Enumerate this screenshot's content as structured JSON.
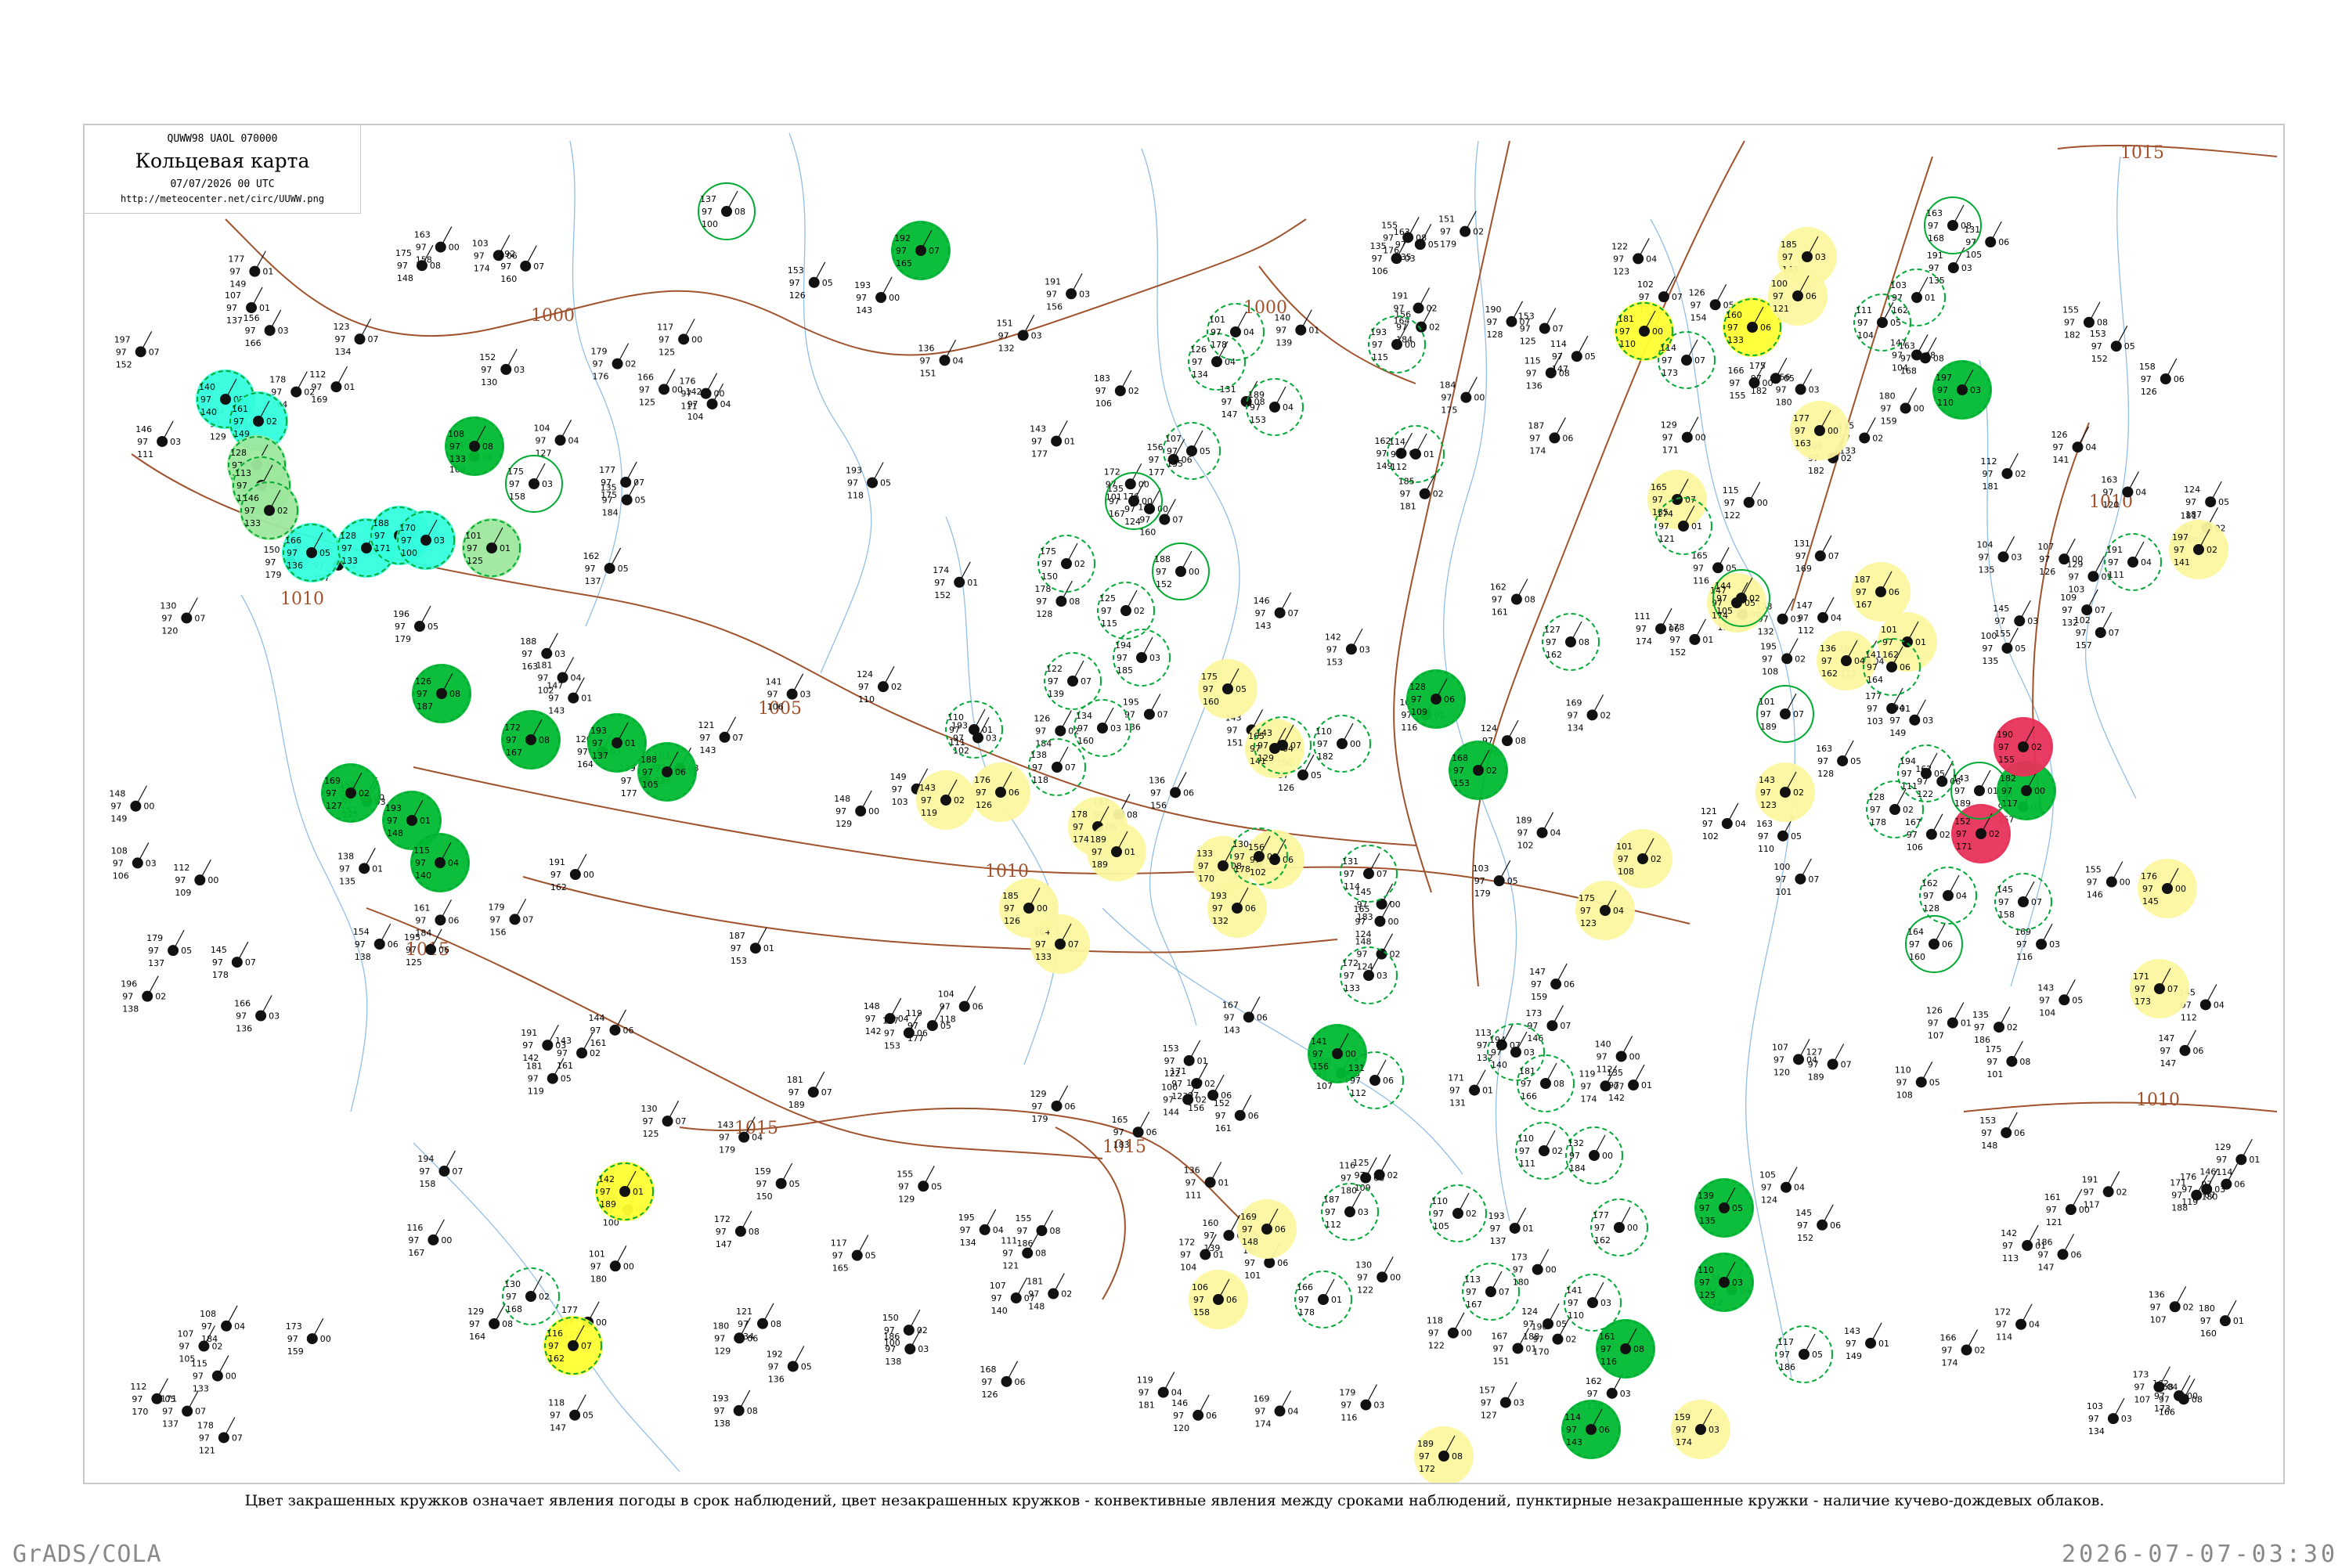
{
  "title_box": {
    "header_code": "QUWW98  UAOL  070000",
    "title": "Кольцевая карта",
    "time": "07/07/2026 00 UTC",
    "url": "http://meteocenter.net/circ/UUWW.png"
  },
  "caption": "Цвет закрашенных кружков означает явления погоды в срок наблюдений, цвет незакрашенных кружков - конвективные явления между сроками наблюдений, пунктирные незакрашенные кружки - наличие кучево-дождевых облаков.",
  "footer": {
    "left": "GrADS/COLA",
    "right": "2026-07-07-03:30"
  },
  "isobars": [
    "1000",
    "1005",
    "1010",
    "1015"
  ],
  "colors": {
    "isobar": "#a0522d",
    "river": "#6fa8dc",
    "thunderstorm": "#00bb33",
    "shower": "#ffff33",
    "fog": "#33ffdd",
    "hail": "#e8325a",
    "weak_shower": "#fbf7a0",
    "convective_ring": "#00bb33",
    "light_rain": "#9ee89e",
    "frame": "#c8c8c8"
  }
}
